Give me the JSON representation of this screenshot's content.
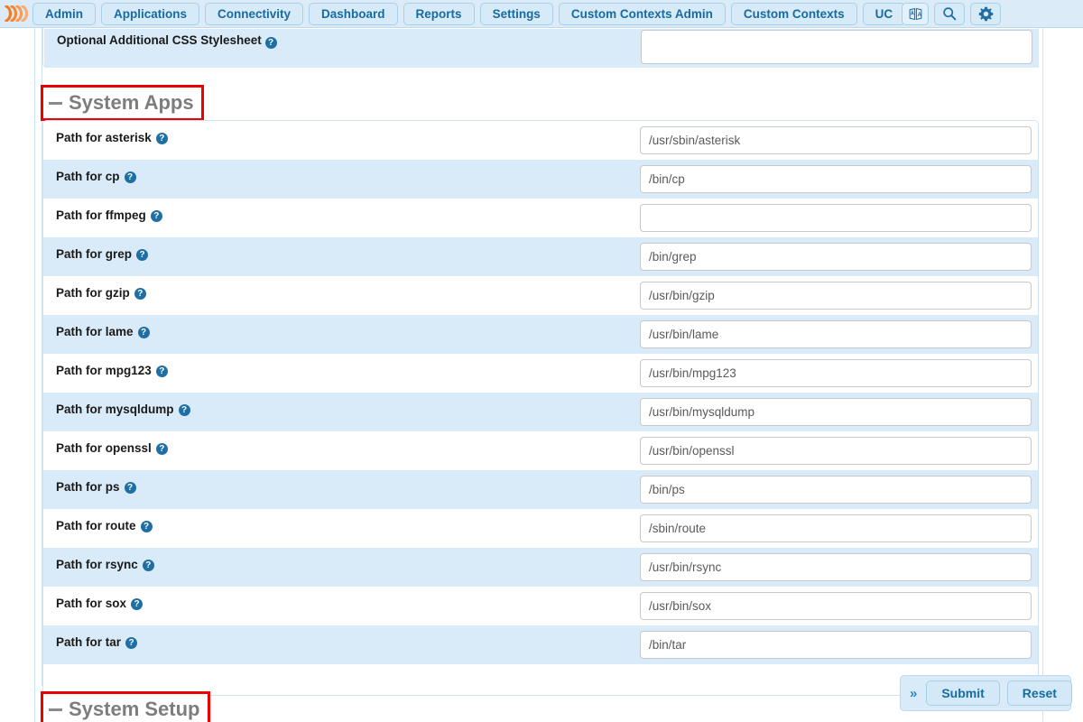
{
  "navbar": {
    "logo_icon": "freepbx-logo-icon",
    "items": [
      {
        "label": "Admin"
      },
      {
        "label": "Applications"
      },
      {
        "label": "Connectivity"
      },
      {
        "label": "Dashboard"
      },
      {
        "label": "Reports"
      },
      {
        "label": "Settings"
      },
      {
        "label": "Custom Contexts Admin"
      },
      {
        "label": "Custom Contexts"
      },
      {
        "label": "UC"
      }
    ],
    "icons": [
      {
        "name": "translate-icon"
      },
      {
        "name": "search-icon"
      },
      {
        "name": "gear-icon"
      }
    ]
  },
  "top_panel": {
    "label": "Optional Additional CSS Stylesheet",
    "help_glyph": "?",
    "textarea_value": ""
  },
  "sections": {
    "system_apps": {
      "title": "System Apps",
      "collapse_icon": "minus-icon",
      "highlighted": true
    },
    "system_setup": {
      "title": "System Setup",
      "collapse_icon": "minus-icon",
      "highlighted": true
    }
  },
  "system_apps_rows": [
    {
      "label": "Path for asterisk",
      "value": "/usr/sbin/asterisk"
    },
    {
      "label": "Path for cp",
      "value": "/bin/cp"
    },
    {
      "label": "Path for ffmpeg",
      "value": ""
    },
    {
      "label": "Path for grep",
      "value": "/bin/grep"
    },
    {
      "label": "Path for gzip",
      "value": "/usr/bin/gzip"
    },
    {
      "label": "Path for lame",
      "value": "/usr/bin/lame"
    },
    {
      "label": "Path for mpg123",
      "value": "/usr/bin/mpg123"
    },
    {
      "label": "Path for mysqldump",
      "value": "/usr/bin/mysqldump"
    },
    {
      "label": "Path for openssl",
      "value": "/usr/bin/openssl"
    },
    {
      "label": "Path for ps",
      "value": "/bin/ps"
    },
    {
      "label": "Path for route",
      "value": "/sbin/route"
    },
    {
      "label": "Path for rsync",
      "value": "/usr/bin/rsync"
    },
    {
      "label": "Path for sox",
      "value": "/usr/bin/sox"
    },
    {
      "label": "Path for tar",
      "value": "/bin/tar"
    }
  ],
  "action_bar": {
    "expand_glyph": "»",
    "submit_label": "Submit",
    "reset_label": "Reset"
  },
  "colors": {
    "nav_bg": "#dbecf8",
    "nav_text": "#176ba0",
    "row_alt_bg": "#d9ebf8",
    "panel_border": "#cfe4f3",
    "heading_text": "#7d7d7d",
    "highlight_box": "#ee0000",
    "help_icon": "#1f6fa5",
    "logo_orange": "#f47b20"
  }
}
